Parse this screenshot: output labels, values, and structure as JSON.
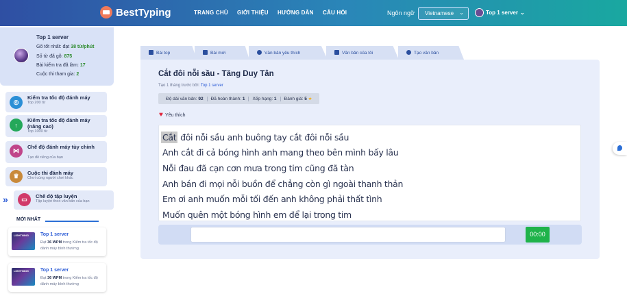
{
  "header": {
    "brand": "BestTyping",
    "nav": [
      "TRANG CHỦ",
      "GIỚI THIỆU",
      "HƯỚNG DẪN",
      "CÂU HỎI"
    ],
    "lang_label": "Ngôn ngữ",
    "lang_value": "Vietnamese",
    "user_name": "Top 1 server"
  },
  "profile": {
    "name": "Top 1 server",
    "best_label": "Gõ tốt nhất: đạt ",
    "best_value": "38 từ/phút",
    "words_label": "Số từ đã gõ: ",
    "words_value": "875",
    "tests_label": "Bài kiểm tra đã làm: ",
    "tests_value": "17",
    "contests_label": "Cuộc thi tham gia: ",
    "contests_value": "2"
  },
  "menu": [
    {
      "title": "Kiểm tra tốc độ đánh máy",
      "sub": "Top 200 từ"
    },
    {
      "title": "Kiểm tra tốc độ đánh máy (nâng cao)",
      "sub": "Top 1000 từ"
    },
    {
      "title": "Chế độ đánh máy tùy chỉnh",
      "sub": "Tạo đề riêng của bạn"
    },
    {
      "title": "Cuộc thi đánh máy",
      "sub": "Chơi cùng người chơi khác"
    },
    {
      "title": "Chế độ tập luyện",
      "sub": "Tập luyện theo văn bản của bạn"
    }
  ],
  "latest": {
    "title": "MỚI NHẤT",
    "cards": [
      {
        "name": "Top 1 server",
        "pre": "Đạt ",
        "wpm": "36 WPM",
        "post": " trong Kiểm tra tốc độ đánh máy bình thường",
        "thumb": "LIGHTNING"
      },
      {
        "name": "Top 1 server",
        "pre": "Đạt ",
        "wpm": "36 WPM",
        "post": " trong Kiểm tra tốc độ đánh máy bình thường",
        "thumb": "LIGHTNING"
      }
    ]
  },
  "tabs": [
    "Bài top",
    "Bài mới",
    "Văn bản yêu thích",
    "Văn bản của tôi",
    "Tạo văn bản"
  ],
  "text": {
    "title": "Cắt đôi nỗi sầu - Tăng Duy Tân",
    "created_prefix": "Tạo 1 tháng trước bởi: ",
    "author": "Top 1 server",
    "stats": {
      "length_label": "Độ dài văn bản: ",
      "length_value": "92",
      "done_label": "Đã hoàn thành: ",
      "done_value": "1",
      "rank_label": "Xếp hạng: ",
      "rank_value": "1",
      "rating_label": "Đánh giá: ",
      "rating_value": "5"
    },
    "favorite": "Yêu thích",
    "highlight_word": "Cắt",
    "first_line_rest": " đôi nỗi sầu anh buông tay cắt đôi nỗi sầu",
    "lines": [
      "Anh cắt đi cả bóng hình anh mang theo bên mình bấy lâu",
      "Nỗi đau đã cạn cơn mưa trong tim cũng đã tàn",
      "Anh bán đi mọi nỗi buồn để chẳng còn gì ngoài thanh thản",
      "Em ơi anh muốn mỗi tối đến anh không phải thất tình",
      "Muốn quên một bóng hình em để lại trong tim"
    ],
    "input_value": "",
    "timer": "00:00"
  },
  "colors": {
    "accent": "#2b5bd6",
    "success": "#1fb34a",
    "highlight": "#c9c9c9",
    "panel": "#e9eefb"
  }
}
